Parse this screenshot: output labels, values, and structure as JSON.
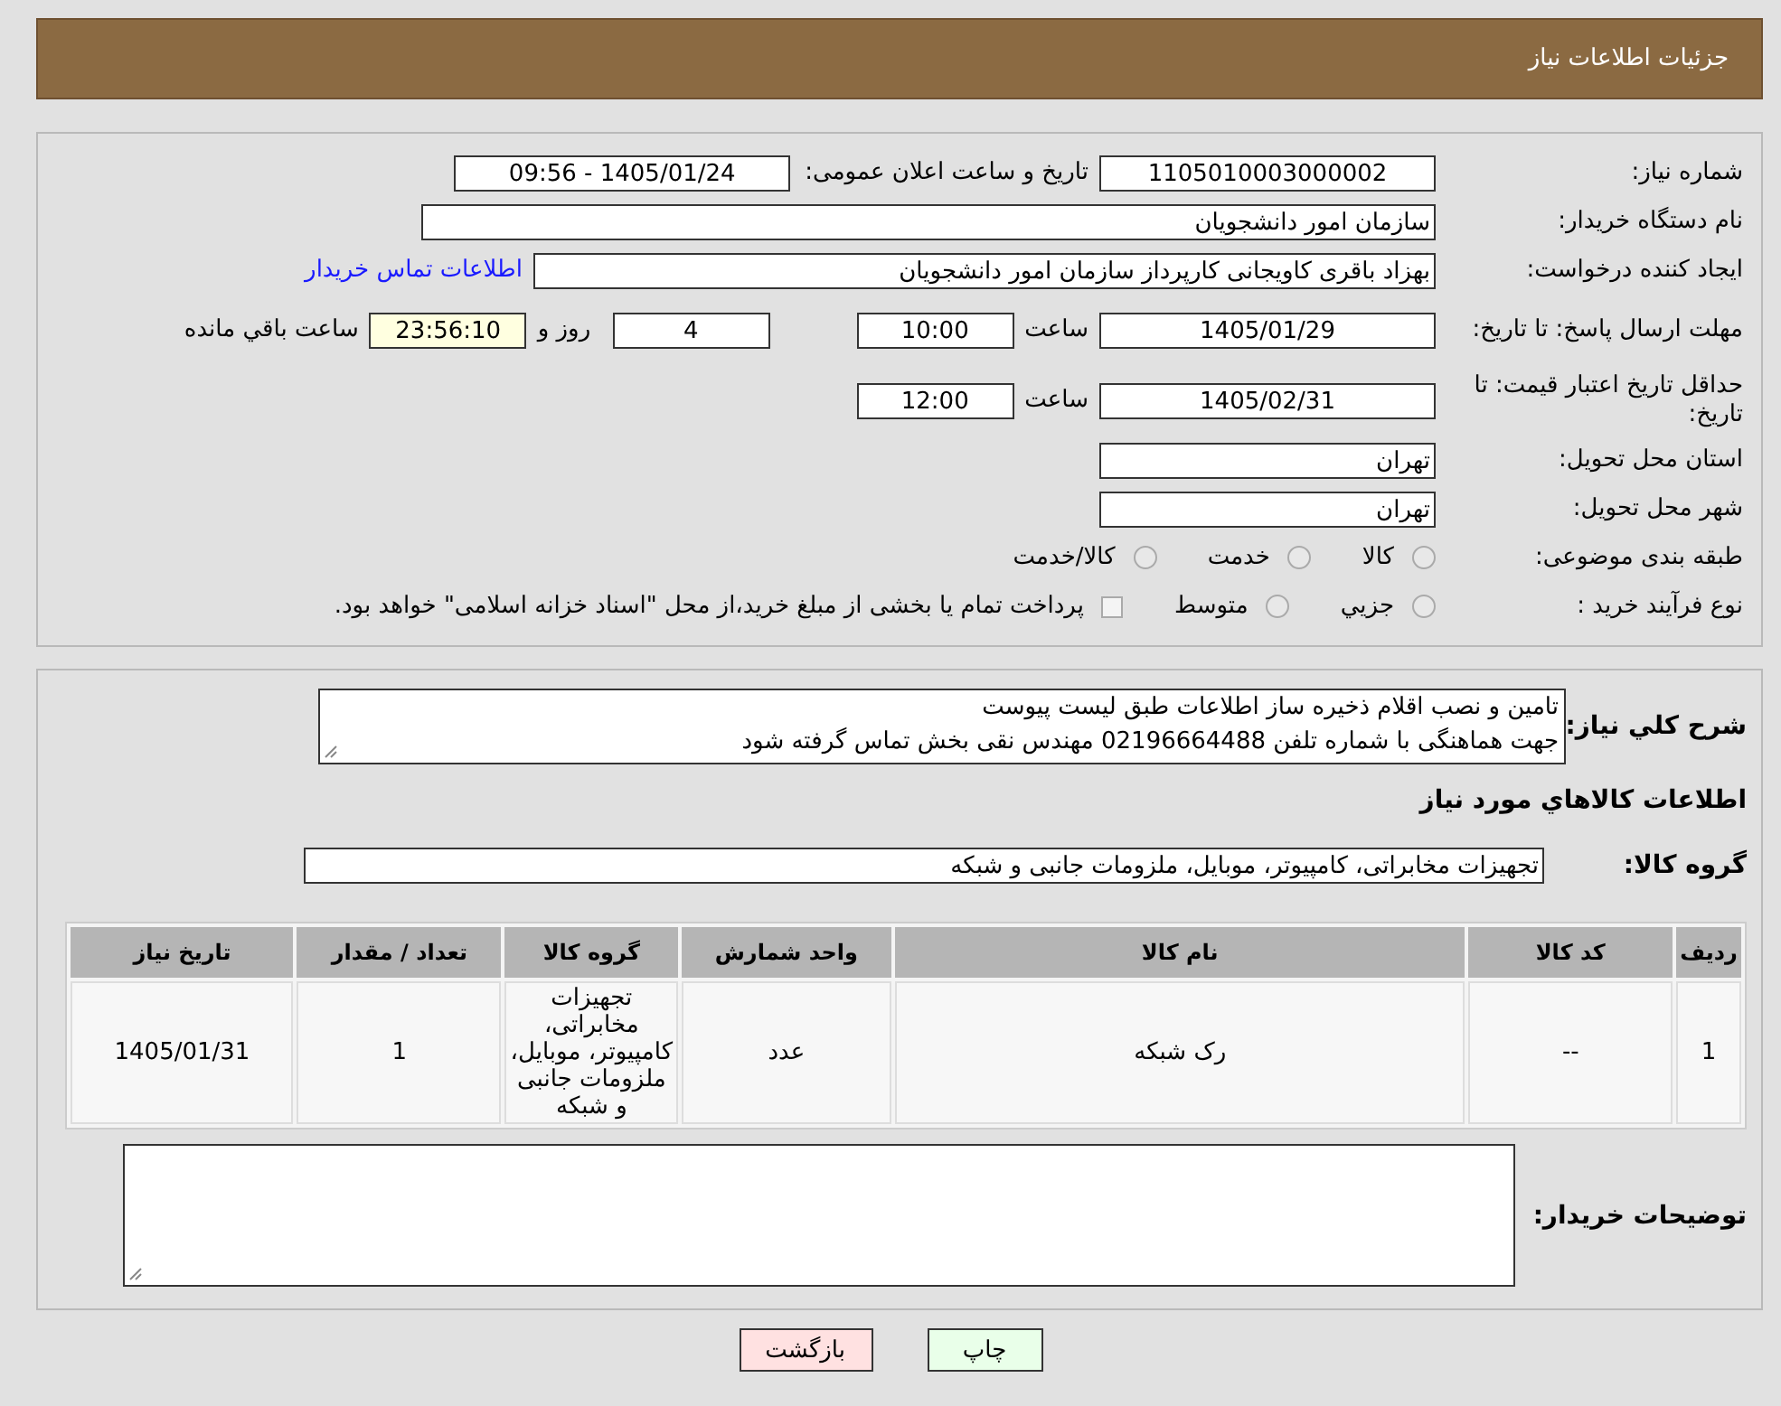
{
  "header": {
    "title": "جزئیات اطلاعات نیاز"
  },
  "details": {
    "need_number": {
      "label": "شماره نیاز:",
      "value": "1105010003000002"
    },
    "announce": {
      "label": "تاریخ و ساعت اعلان عمومی:",
      "value": "1405/01/24 - 09:56"
    },
    "buyer_org": {
      "label": "نام دستگاه خریدار:",
      "value": "سازمان امور دانشجویان"
    },
    "requester": {
      "label": "ایجاد کننده درخواست:",
      "value": "بهزاد باقری کاویجانی کارپرداز سازمان امور دانشجویان",
      "link": "اطلاعات تماس خریدار"
    },
    "deadline": {
      "label": "مهلت ارسال پاسخ: تا تاریخ:",
      "date": "1405/01/29",
      "time_label": "ساعت",
      "time": "10:00",
      "days": "4",
      "days_label": "روز و",
      "remaining": "23:56:10",
      "remaining_label": "ساعت باقي مانده"
    },
    "validity": {
      "label": "حداقل تاریخ اعتبار قیمت: تا تاریخ:",
      "date": "1405/02/31",
      "time_label": "ساعت",
      "time": "12:00"
    },
    "province": {
      "label": "استان محل تحویل:",
      "value": "تهران"
    },
    "city": {
      "label": "شهر محل تحویل:",
      "value": "تهران"
    },
    "category": {
      "label": "طبقه بندی موضوعی:",
      "options": [
        {
          "label": "كالا",
          "selected": false
        },
        {
          "label": "خدمت",
          "selected": false
        },
        {
          "label": "كالا/خدمت",
          "selected": false
        }
      ]
    },
    "process": {
      "label": "نوع فرآیند خرید :",
      "options": [
        {
          "label": "جزيي",
          "selected": false
        },
        {
          "label": "متوسط",
          "selected": false
        }
      ],
      "payment": {
        "label": "پرداخت تمام یا بخشی از مبلغ خرید،از محل \"اسناد خزانه اسلامی\" خواهد بود.",
        "checked": false
      }
    }
  },
  "summary": {
    "label": "شرح كلي نياز:",
    "lines": [
      "تامین و نصب اقلام ذخیره ساز اطلاعات طبق لیست پیوست",
      "جهت هماهنگی با شماره تلفن 02196664488 مهندس نقی بخش تماس گرفته شود"
    ]
  },
  "goods_title": "اطلاعات كالاهاي مورد نياز",
  "goods_group": {
    "label": "گروه كالا:",
    "value": "تجهیزات مخابراتی، کامپیوتر، موبایل، ملزومات جانبی و شبکه"
  },
  "table": {
    "columns": [
      "ردیف",
      "کد کالا",
      "نام کالا",
      "واحد شمارش",
      "گروه کالا",
      "تعداد / مقدار",
      "تاریخ نیاز"
    ],
    "rows": [
      [
        "1",
        "--",
        "رک شبکه",
        "عدد",
        "تجهیزات مخابراتی، کامپیوتر، موبایل، ملزومات جانبی و شبکه",
        "1",
        "1405/01/31"
      ]
    ]
  },
  "buyer_notes": {
    "label": "توضیحات خریدار:"
  },
  "buttons": [
    {
      "label": "چاپ",
      "kind": "print"
    },
    {
      "label": "بازگشت",
      "kind": "back"
    }
  ]
}
